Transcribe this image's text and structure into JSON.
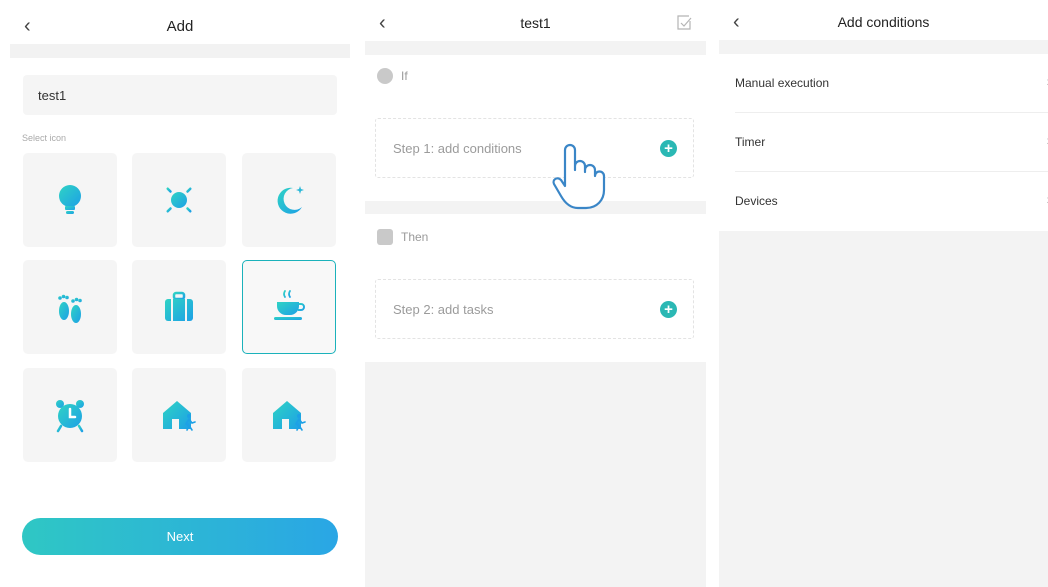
{
  "screen_add": {
    "back_glyph": "‹",
    "title": "Add",
    "name_value": "test1",
    "select_icon_label": "Select icon",
    "icons": [
      "bulb-icon",
      "sun-icon",
      "moon-icon",
      "footprints-icon",
      "suitcase-icon",
      "coffee-cup-icon",
      "alarm-clock-icon",
      "home-arrive-icon",
      "home-leave-icon"
    ],
    "selected_icon": "coffee-cup-icon",
    "next_label": "Next"
  },
  "screen_scene": {
    "back_glyph": "‹",
    "title": "test1",
    "if_label": "If",
    "step1_label": "Step 1: add conditions",
    "then_label": "Then",
    "step2_label": "Step 2: add tasks",
    "plus_glyph": "+"
  },
  "screen_conditions": {
    "back_glyph": "‹",
    "title": "Add conditions",
    "items": [
      {
        "label": "Manual execution"
      },
      {
        "label": "Timer"
      },
      {
        "label": "Devices"
      }
    ],
    "chevron_glyph": "›"
  },
  "colors": {
    "accent": "#1bb2bb",
    "icon_gradient_start": "#2fd3c4",
    "icon_gradient_end": "#1da0e6",
    "button_gradient_start": "#2fc7c4",
    "button_gradient_end": "#2aa6e5"
  }
}
